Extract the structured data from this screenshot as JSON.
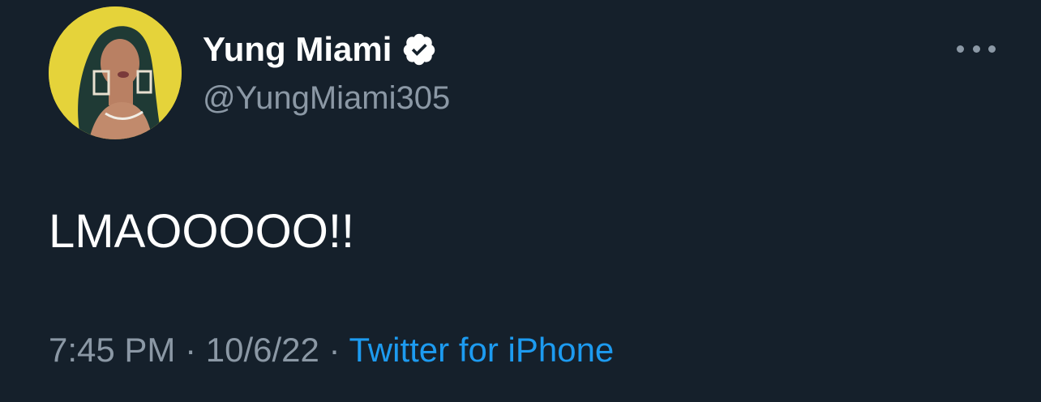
{
  "author": {
    "display_name": "Yung Miami",
    "handle": "@YungMiami305",
    "verified": true
  },
  "tweet": {
    "text": "LMAOOOOO!!"
  },
  "meta": {
    "time": "7:45 PM",
    "separator": " · ",
    "date": "10/6/22",
    "source": "Twitter for iPhone"
  },
  "icons": {
    "verified": "verified-badge-icon",
    "more": "more-options-icon"
  },
  "colors": {
    "background": "#15202b",
    "text_primary": "#ffffff",
    "text_secondary": "#8b98a5",
    "link": "#1d9bf0",
    "avatar_bg": "#e5d33a"
  }
}
